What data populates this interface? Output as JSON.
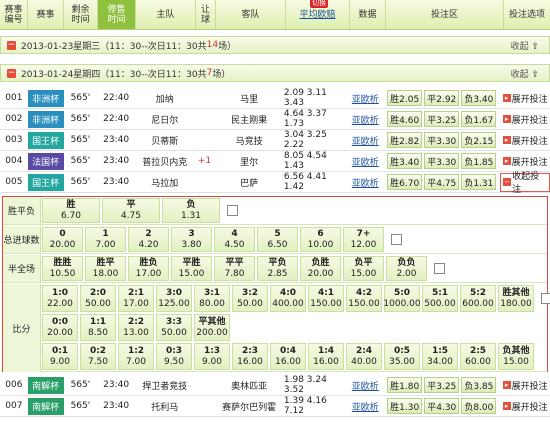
{
  "header": {
    "cols": [
      "赛事\n编号",
      "赛事",
      "剩余\n时间",
      "停售\n时间",
      "主队",
      "让\n球",
      "客队",
      "平均欧赔",
      "数据",
      "投注区",
      "投注选项"
    ],
    "badge": "切换"
  },
  "date1": {
    "text": "2013-01-23星期三（11：30--次日11：30共",
    "count": "14",
    "suffix": "场）",
    "fold": "收起"
  },
  "date2": {
    "text": "2013-01-24星期四（11：30--次日11：30共",
    "count": "7",
    "suffix": "场）",
    "fold": "收起"
  },
  "matches": [
    {
      "no": "001",
      "league": "非洲杯",
      "lcolor": "#2a8fbf",
      "remain": "565'",
      "time": "22:40",
      "home": "加纳",
      "hc": "",
      "away": "马里",
      "odds": "2.09 3.11 3.43",
      "analysis": "亚欧析",
      "w": "胜2.05",
      "d": "平2.92",
      "l": "负3.40",
      "opt": "展开投注"
    },
    {
      "no": "002",
      "league": "非洲杯",
      "lcolor": "#2a8fbf",
      "remain": "565'",
      "time": "22:40",
      "home": "尼日尔",
      "hc": "",
      "away": "民主刚果",
      "odds": "4.64 3.37 1.73",
      "analysis": "亚欧析",
      "w": "胜4.60",
      "d": "平3.25",
      "l": "负1.67",
      "opt": "展开投注"
    },
    {
      "no": "003",
      "league": "国王杯",
      "lcolor": "#23a6a0",
      "remain": "565'",
      "time": "23:40",
      "home": "贝蒂斯",
      "hc": "",
      "away": "马竞技",
      "odds": "3.04 3.25 2.22",
      "analysis": "亚欧析",
      "w": "胜2.82",
      "d": "平3.30",
      "l": "负2.15",
      "opt": "展开投注"
    },
    {
      "no": "004",
      "league": "法国杯",
      "lcolor": "#5a4aa6",
      "remain": "565'",
      "time": "23:40",
      "home": "普拉贝内克",
      "hc": "+1",
      "away": "里尔",
      "odds": "8.05 4.54 1.43",
      "analysis": "亚欧析",
      "w": "胜3.40",
      "d": "平3.30",
      "l": "负1.85",
      "opt": "展开投注"
    },
    {
      "no": "005",
      "league": "国王杯",
      "lcolor": "#23a6a0",
      "remain": "565'",
      "time": "23:40",
      "home": "马拉加",
      "hc": "",
      "away": "巴萨",
      "odds": "6.56 4.41 1.42",
      "analysis": "亚欧析",
      "w": "胜6.70",
      "d": "平4.75",
      "l": "负1.31",
      "opt": "收起投注"
    },
    {
      "no": "006",
      "league": "南解杯",
      "lcolor": "#2a9f6a",
      "remain": "565'",
      "time": "23:40",
      "home": "捍卫者竞技",
      "hc": "",
      "away": "奥林匹亚",
      "odds": "1.98 3.24 3.52",
      "analysis": "亚欧析",
      "w": "胜1.80",
      "d": "平3.25",
      "l": "负3.85",
      "opt": "展开投注"
    },
    {
      "no": "007",
      "league": "南解杯",
      "lcolor": "#2a9f6a",
      "remain": "565'",
      "time": "23:40",
      "home": "托利马",
      "hc": "",
      "away": "赛萨尔巴列霍",
      "odds": "1.39 4.16 7.12",
      "analysis": "亚欧析",
      "w": "胜1.30",
      "d": "平4.30",
      "l": "负8.00",
      "opt": "展开投注"
    }
  ],
  "detail": {
    "wdl": {
      "label": "胜平负",
      "items": [
        [
          "胜",
          "6.70"
        ],
        [
          "平",
          "4.75"
        ],
        [
          "负",
          "1.31"
        ]
      ]
    },
    "goals": {
      "label": "总进球数",
      "items": [
        [
          "0",
          "20.00"
        ],
        [
          "1",
          "7.00"
        ],
        [
          "2",
          "4.20"
        ],
        [
          "3",
          "3.80"
        ],
        [
          "4",
          "4.50"
        ],
        [
          "5",
          "6.50"
        ],
        [
          "6",
          "10.00"
        ],
        [
          "7+",
          "12.00"
        ]
      ]
    },
    "half": {
      "label": "半全场",
      "items": [
        [
          "胜胜",
          "10.50"
        ],
        [
          "胜平",
          "18.00"
        ],
        [
          "胜负",
          "17.00"
        ],
        [
          "平胜",
          "15.00"
        ],
        [
          "平平",
          "7.80"
        ],
        [
          "平负",
          "2.85"
        ],
        [
          "负胜",
          "20.00"
        ],
        [
          "负平",
          "15.00"
        ],
        [
          "负负",
          "2.00"
        ]
      ]
    },
    "score": {
      "label": "比分",
      "r1": [
        [
          "1:0",
          "22.00"
        ],
        [
          "2:0",
          "50.00"
        ],
        [
          "2:1",
          "17.00"
        ],
        [
          "3:0",
          "125.00"
        ],
        [
          "3:1",
          "80.00"
        ],
        [
          "3:2",
          "50.00"
        ],
        [
          "4:0",
          "400.00"
        ],
        [
          "4:1",
          "150.00"
        ],
        [
          "4:2",
          "150.00"
        ],
        [
          "5:0",
          "1000.00"
        ],
        [
          "5:1",
          "500.00"
        ],
        [
          "5:2",
          "600.00"
        ],
        [
          "胜其他",
          "180.00"
        ]
      ],
      "r2": [
        [
          "0:0",
          "20.00"
        ],
        [
          "1:1",
          "8.50"
        ],
        [
          "2:2",
          "13.00"
        ],
        [
          "3:3",
          "50.00"
        ],
        [
          "平其他",
          "200.00"
        ]
      ],
      "r3": [
        [
          "0:1",
          "9.00"
        ],
        [
          "0:2",
          "7.50"
        ],
        [
          "1:2",
          "7.00"
        ],
        [
          "0:3",
          "9.50"
        ],
        [
          "1:3",
          "9.00"
        ],
        [
          "2:3",
          "16.00"
        ],
        [
          "0:4",
          "16.00"
        ],
        [
          "1:4",
          "16.00"
        ],
        [
          "2:4",
          "40.00"
        ],
        [
          "0:5",
          "35.00"
        ],
        [
          "1:5",
          "34.00"
        ],
        [
          "2:5",
          "60.00"
        ],
        [
          "负其他",
          "15.00"
        ]
      ]
    }
  }
}
